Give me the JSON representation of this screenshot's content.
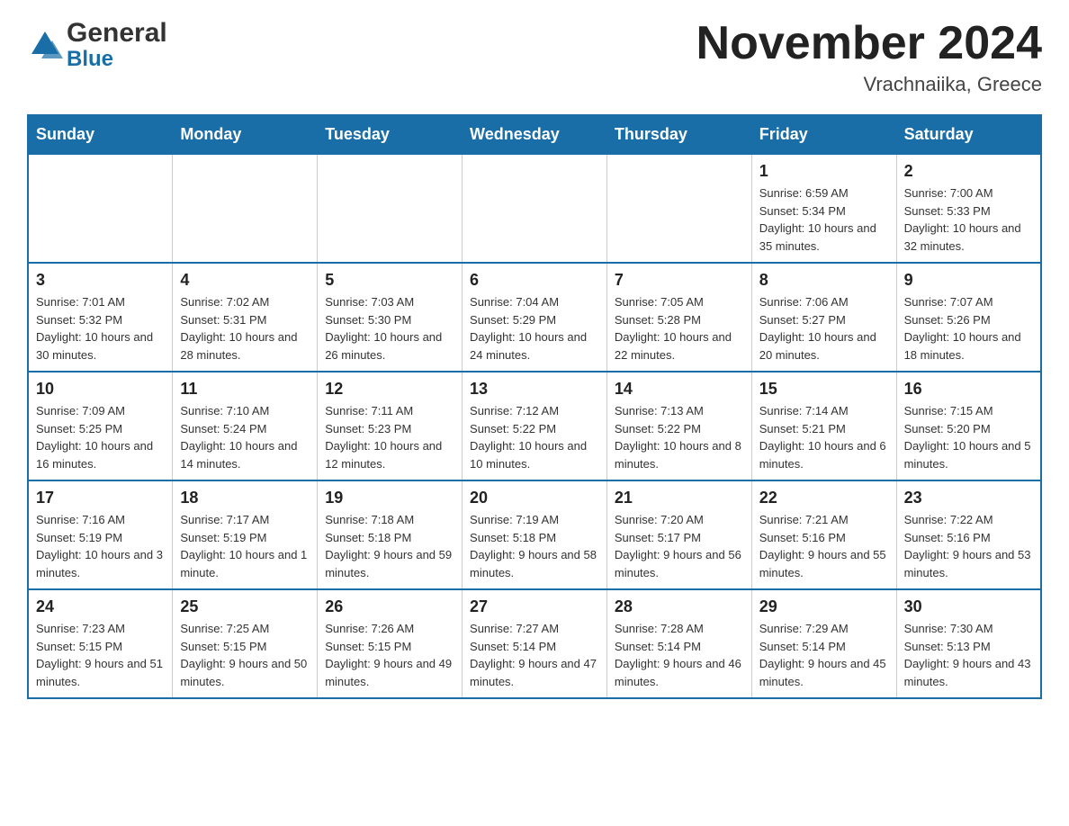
{
  "header": {
    "logo": {
      "general": "General",
      "blue": "Blue"
    },
    "title": "November 2024",
    "location": "Vrachnaiika, Greece"
  },
  "calendar": {
    "days_of_week": [
      "Sunday",
      "Monday",
      "Tuesday",
      "Wednesday",
      "Thursday",
      "Friday",
      "Saturday"
    ],
    "weeks": [
      [
        {
          "day": "",
          "info": ""
        },
        {
          "day": "",
          "info": ""
        },
        {
          "day": "",
          "info": ""
        },
        {
          "day": "",
          "info": ""
        },
        {
          "day": "",
          "info": ""
        },
        {
          "day": "1",
          "info": "Sunrise: 6:59 AM\nSunset: 5:34 PM\nDaylight: 10 hours and 35 minutes."
        },
        {
          "day": "2",
          "info": "Sunrise: 7:00 AM\nSunset: 5:33 PM\nDaylight: 10 hours and 32 minutes."
        }
      ],
      [
        {
          "day": "3",
          "info": "Sunrise: 7:01 AM\nSunset: 5:32 PM\nDaylight: 10 hours and 30 minutes."
        },
        {
          "day": "4",
          "info": "Sunrise: 7:02 AM\nSunset: 5:31 PM\nDaylight: 10 hours and 28 minutes."
        },
        {
          "day": "5",
          "info": "Sunrise: 7:03 AM\nSunset: 5:30 PM\nDaylight: 10 hours and 26 minutes."
        },
        {
          "day": "6",
          "info": "Sunrise: 7:04 AM\nSunset: 5:29 PM\nDaylight: 10 hours and 24 minutes."
        },
        {
          "day": "7",
          "info": "Sunrise: 7:05 AM\nSunset: 5:28 PM\nDaylight: 10 hours and 22 minutes."
        },
        {
          "day": "8",
          "info": "Sunrise: 7:06 AM\nSunset: 5:27 PM\nDaylight: 10 hours and 20 minutes."
        },
        {
          "day": "9",
          "info": "Sunrise: 7:07 AM\nSunset: 5:26 PM\nDaylight: 10 hours and 18 minutes."
        }
      ],
      [
        {
          "day": "10",
          "info": "Sunrise: 7:09 AM\nSunset: 5:25 PM\nDaylight: 10 hours and 16 minutes."
        },
        {
          "day": "11",
          "info": "Sunrise: 7:10 AM\nSunset: 5:24 PM\nDaylight: 10 hours and 14 minutes."
        },
        {
          "day": "12",
          "info": "Sunrise: 7:11 AM\nSunset: 5:23 PM\nDaylight: 10 hours and 12 minutes."
        },
        {
          "day": "13",
          "info": "Sunrise: 7:12 AM\nSunset: 5:22 PM\nDaylight: 10 hours and 10 minutes."
        },
        {
          "day": "14",
          "info": "Sunrise: 7:13 AM\nSunset: 5:22 PM\nDaylight: 10 hours and 8 minutes."
        },
        {
          "day": "15",
          "info": "Sunrise: 7:14 AM\nSunset: 5:21 PM\nDaylight: 10 hours and 6 minutes."
        },
        {
          "day": "16",
          "info": "Sunrise: 7:15 AM\nSunset: 5:20 PM\nDaylight: 10 hours and 5 minutes."
        }
      ],
      [
        {
          "day": "17",
          "info": "Sunrise: 7:16 AM\nSunset: 5:19 PM\nDaylight: 10 hours and 3 minutes."
        },
        {
          "day": "18",
          "info": "Sunrise: 7:17 AM\nSunset: 5:19 PM\nDaylight: 10 hours and 1 minute."
        },
        {
          "day": "19",
          "info": "Sunrise: 7:18 AM\nSunset: 5:18 PM\nDaylight: 9 hours and 59 minutes."
        },
        {
          "day": "20",
          "info": "Sunrise: 7:19 AM\nSunset: 5:18 PM\nDaylight: 9 hours and 58 minutes."
        },
        {
          "day": "21",
          "info": "Sunrise: 7:20 AM\nSunset: 5:17 PM\nDaylight: 9 hours and 56 minutes."
        },
        {
          "day": "22",
          "info": "Sunrise: 7:21 AM\nSunset: 5:16 PM\nDaylight: 9 hours and 55 minutes."
        },
        {
          "day": "23",
          "info": "Sunrise: 7:22 AM\nSunset: 5:16 PM\nDaylight: 9 hours and 53 minutes."
        }
      ],
      [
        {
          "day": "24",
          "info": "Sunrise: 7:23 AM\nSunset: 5:15 PM\nDaylight: 9 hours and 51 minutes."
        },
        {
          "day": "25",
          "info": "Sunrise: 7:25 AM\nSunset: 5:15 PM\nDaylight: 9 hours and 50 minutes."
        },
        {
          "day": "26",
          "info": "Sunrise: 7:26 AM\nSunset: 5:15 PM\nDaylight: 9 hours and 49 minutes."
        },
        {
          "day": "27",
          "info": "Sunrise: 7:27 AM\nSunset: 5:14 PM\nDaylight: 9 hours and 47 minutes."
        },
        {
          "day": "28",
          "info": "Sunrise: 7:28 AM\nSunset: 5:14 PM\nDaylight: 9 hours and 46 minutes."
        },
        {
          "day": "29",
          "info": "Sunrise: 7:29 AM\nSunset: 5:14 PM\nDaylight: 9 hours and 45 minutes."
        },
        {
          "day": "30",
          "info": "Sunrise: 7:30 AM\nSunset: 5:13 PM\nDaylight: 9 hours and 43 minutes."
        }
      ]
    ]
  }
}
